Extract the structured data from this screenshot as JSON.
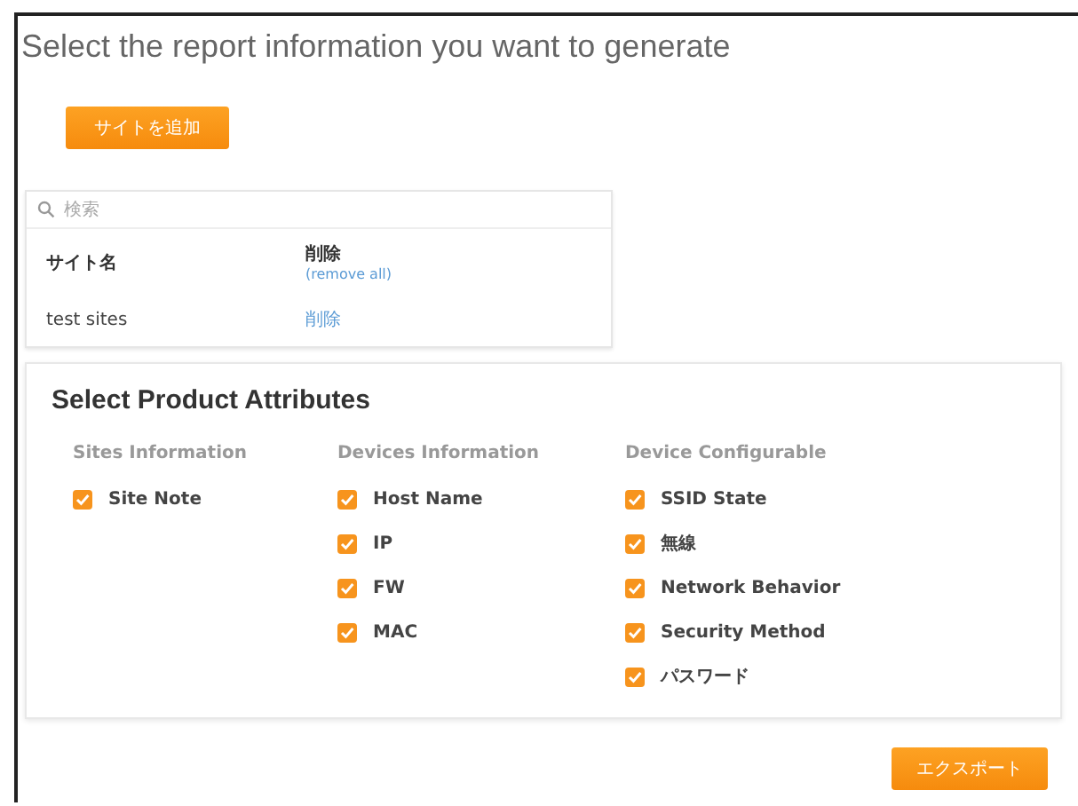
{
  "title": "Select the report information you want to generate",
  "add_site_button": "サイトを追加",
  "sites_table": {
    "search": {
      "placeholder": "検索"
    },
    "columns": [
      {
        "label": "サイト名"
      },
      {
        "label": "削除",
        "link": "(remove all)"
      }
    ],
    "rows": [
      {
        "name": "test sites",
        "action": "削除"
      }
    ]
  },
  "attributes": {
    "title": "Select Product Attributes",
    "groups": [
      {
        "heading": "Sites Information",
        "items": [
          {
            "label": "Site Note",
            "checked": true
          }
        ]
      },
      {
        "heading": "Devices Information",
        "items": [
          {
            "label": "Host Name",
            "checked": true
          },
          {
            "label": "IP",
            "checked": true
          },
          {
            "label": "FW",
            "checked": true
          },
          {
            "label": "MAC",
            "checked": true
          }
        ]
      },
      {
        "heading": "Device Configurable",
        "items": [
          {
            "label": "SSID State",
            "checked": true
          },
          {
            "label": "無線",
            "checked": true
          },
          {
            "label": "Network Behavior",
            "checked": true
          },
          {
            "label": "Security Method",
            "checked": true
          },
          {
            "label": "パスワード",
            "checked": true
          }
        ]
      }
    ]
  },
  "export_button": "エクスポート"
}
